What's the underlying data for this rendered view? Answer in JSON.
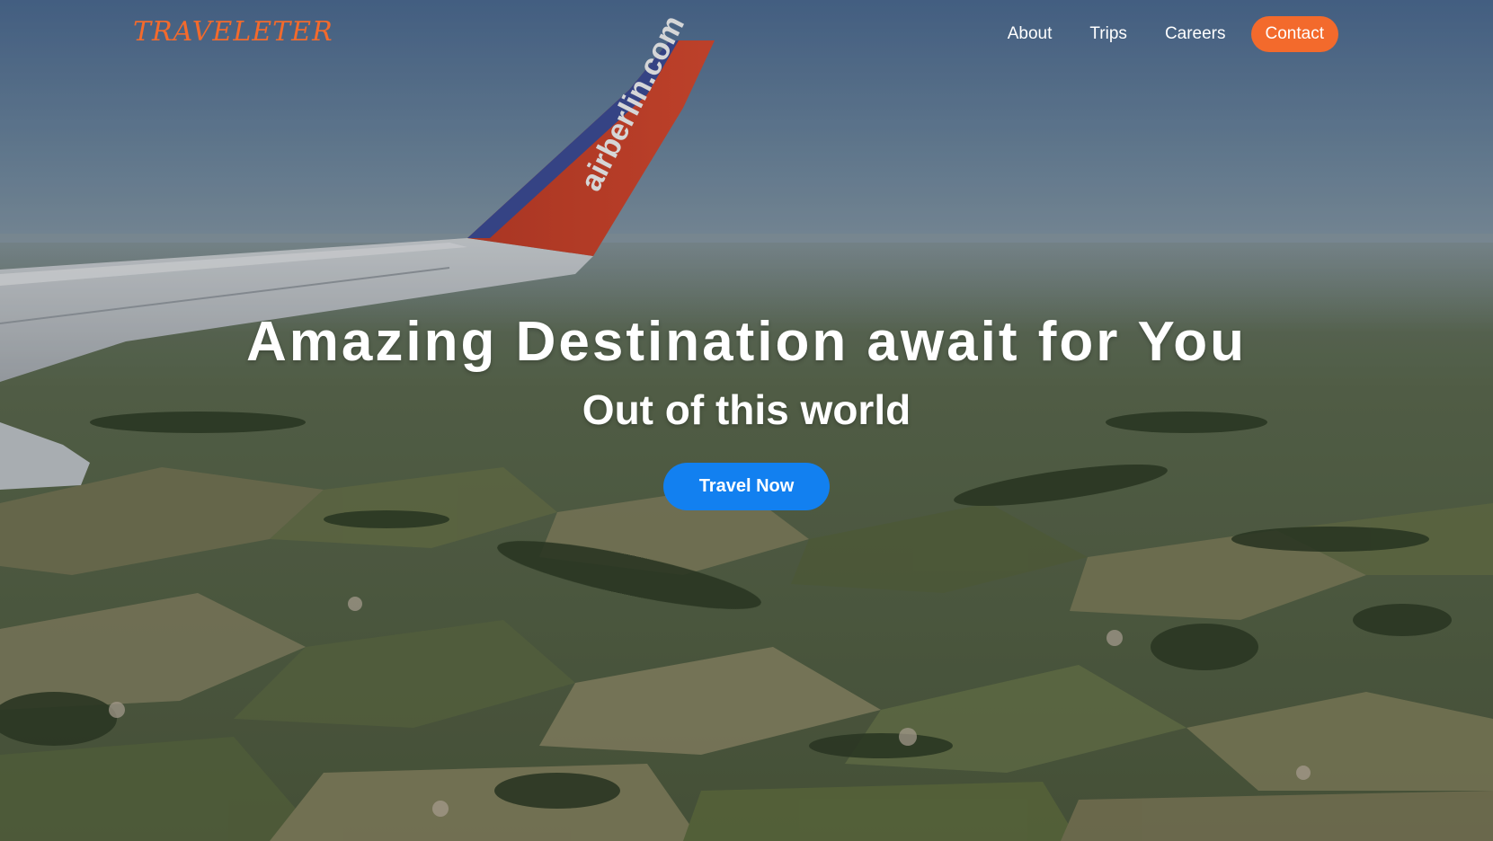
{
  "brand": {
    "logo_text": "TRAVELETER",
    "accent_color": "#f36a2c"
  },
  "nav": {
    "items": [
      {
        "label": "About",
        "active": false
      },
      {
        "label": "Trips",
        "active": false
      },
      {
        "label": "Careers",
        "active": false
      },
      {
        "label": "Contact",
        "active": true
      }
    ]
  },
  "hero": {
    "title": "Amazing Destination await for You",
    "subtitle": "Out of this world",
    "cta_label": "Travel Now",
    "cta_color": "#1280f0",
    "background_image": "airplane-wing-over-farmland",
    "wing_logo_text": "airberlin.com"
  }
}
